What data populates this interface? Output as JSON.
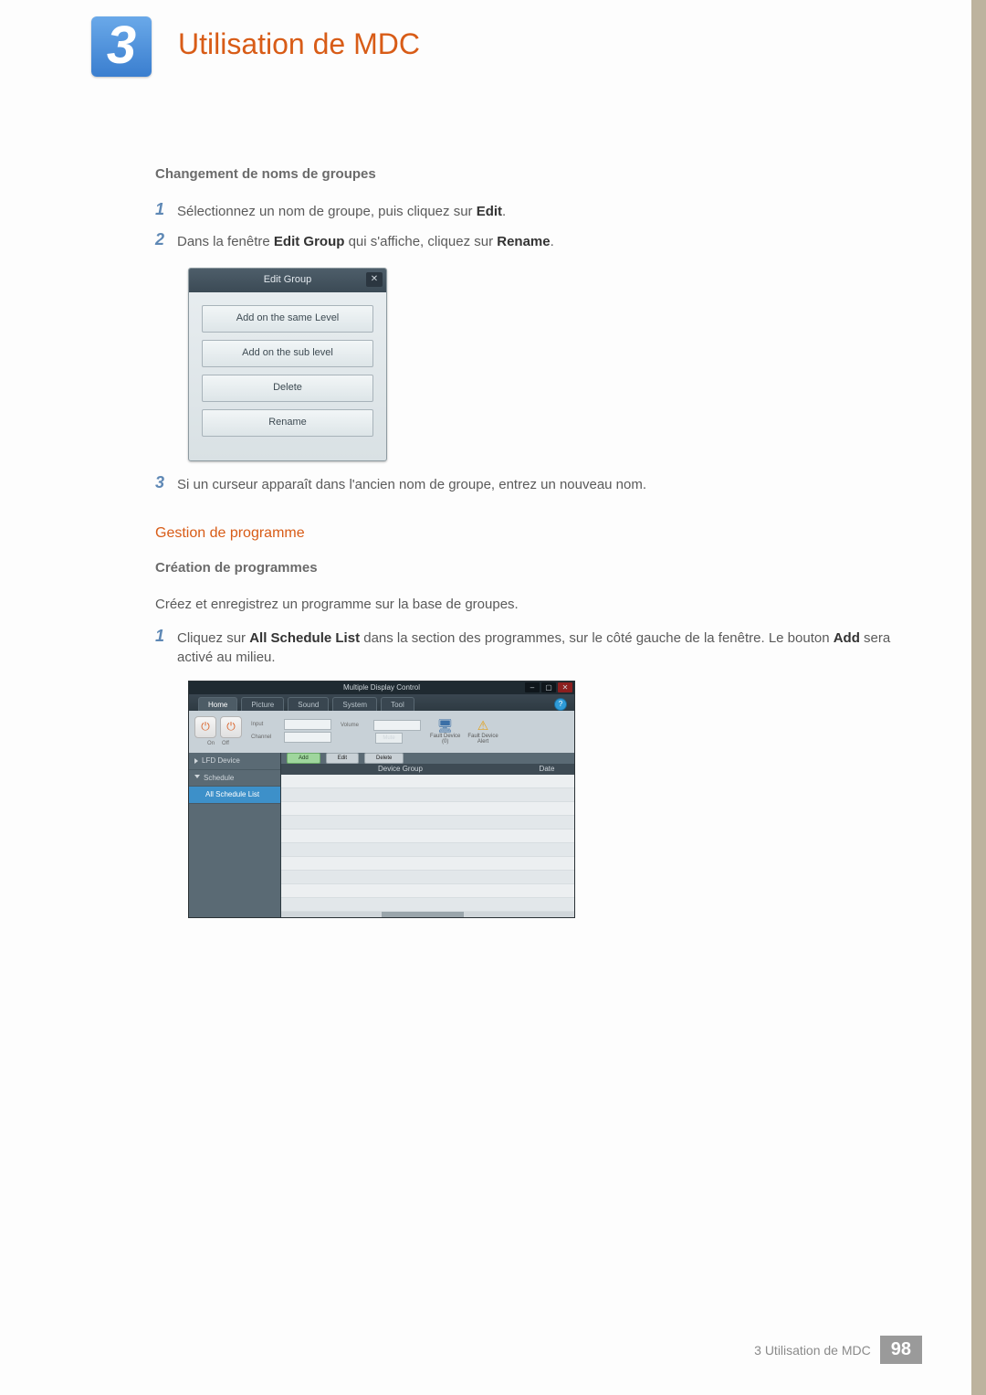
{
  "chapter": {
    "number": "3",
    "title": "Utilisation de MDC"
  },
  "section_group_rename": {
    "heading": "Changement de noms de groupes",
    "steps": {
      "s1": {
        "num": "1",
        "pre": "Sélectionnez un nom de groupe, puis cliquez sur ",
        "bold": "Edit",
        "post": "."
      },
      "s2": {
        "num": "2",
        "pre": "Dans la fenêtre ",
        "bold1": "Edit Group",
        "mid": " qui s'affiche, cliquez sur ",
        "bold2": "Rename",
        "post": "."
      },
      "s3": {
        "num": "3",
        "text": "Si un curseur apparaît dans l'ancien nom de groupe, entrez un nouveau nom."
      }
    }
  },
  "dialog": {
    "title": "Edit Group",
    "buttons": [
      "Add on the same Level",
      "Add on the sub level",
      "Delete",
      "Rename"
    ]
  },
  "section_schedule": {
    "heading": "Gestion de programme",
    "sub": {
      "heading": "Création de programmes",
      "intro": "Créez et enregistrez un programme sur la base de groupes.",
      "steps": {
        "s1": {
          "num": "1",
          "pre": "Cliquez sur ",
          "bold1": "All Schedule List",
          "mid": " dans la section des programmes, sur le côté gauche de la fenêtre. Le bouton ",
          "bold2": "Add",
          "post": " sera activé au milieu."
        }
      }
    }
  },
  "mdc": {
    "title": "Multiple Display Control",
    "tabs": [
      "Home",
      "Picture",
      "Sound",
      "System",
      "Tool"
    ],
    "ribbon": {
      "power": {
        "on": "On",
        "off": "Off",
        "glyph": "⏻"
      },
      "input_label": "Input",
      "channel_label": "Channel",
      "volume_label": "Volume",
      "mute": "Mute",
      "fault_device": {
        "label": "Fault Device",
        "count": "(0)"
      },
      "fault_alert": {
        "label": "Fault Device",
        "sub": "Alert"
      }
    },
    "sidebar": {
      "lfd": "LFD Device",
      "schedule": "Schedule",
      "all_list": "All Schedule List"
    },
    "actions": {
      "add": "Add",
      "edit": "Edit",
      "delete": "Delete"
    },
    "columns": {
      "group": "Device Group",
      "date": "Date"
    },
    "help": "?"
  },
  "footer": {
    "text": "3 Utilisation de MDC",
    "page": "98"
  }
}
